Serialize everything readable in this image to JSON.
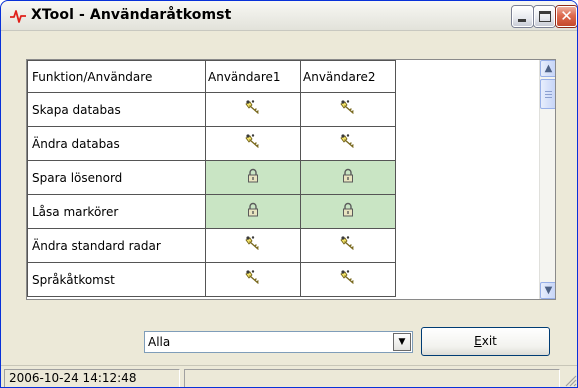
{
  "window": {
    "title": "XTool - Användaråtkomst",
    "controls": {
      "minimize": "minimize-icon",
      "maximize": "maximize-icon",
      "close": "close-icon"
    }
  },
  "grid": {
    "columns": [
      "Funktion/Användare",
      "Användare1",
      "Användare2"
    ],
    "rows": [
      {
        "function": "Skapa databas",
        "cells": [
          "key-icon",
          "key-icon"
        ],
        "highlight": false
      },
      {
        "function": "Ändra databas",
        "cells": [
          "key-icon",
          "key-icon"
        ],
        "highlight": false
      },
      {
        "function": "Spara lösenord",
        "cells": [
          "lock-icon",
          "lock-icon"
        ],
        "highlight": true
      },
      {
        "function": "Låsa markörer",
        "cells": [
          "lock-icon",
          "lock-icon"
        ],
        "highlight": true
      },
      {
        "function": "Ändra standard radar",
        "cells": [
          "key-icon",
          "key-icon"
        ],
        "highlight": false
      },
      {
        "function": "Språkåtkomst",
        "cells": [
          "key-icon",
          "key-icon"
        ],
        "highlight": false
      }
    ],
    "highlight_color": "#c9e5c4"
  },
  "filter": {
    "selected": "Alla"
  },
  "exit_button": {
    "label_first": "E",
    "label_rest": "xit"
  },
  "status": {
    "timestamp": "2006-10-24 14:12:48"
  }
}
